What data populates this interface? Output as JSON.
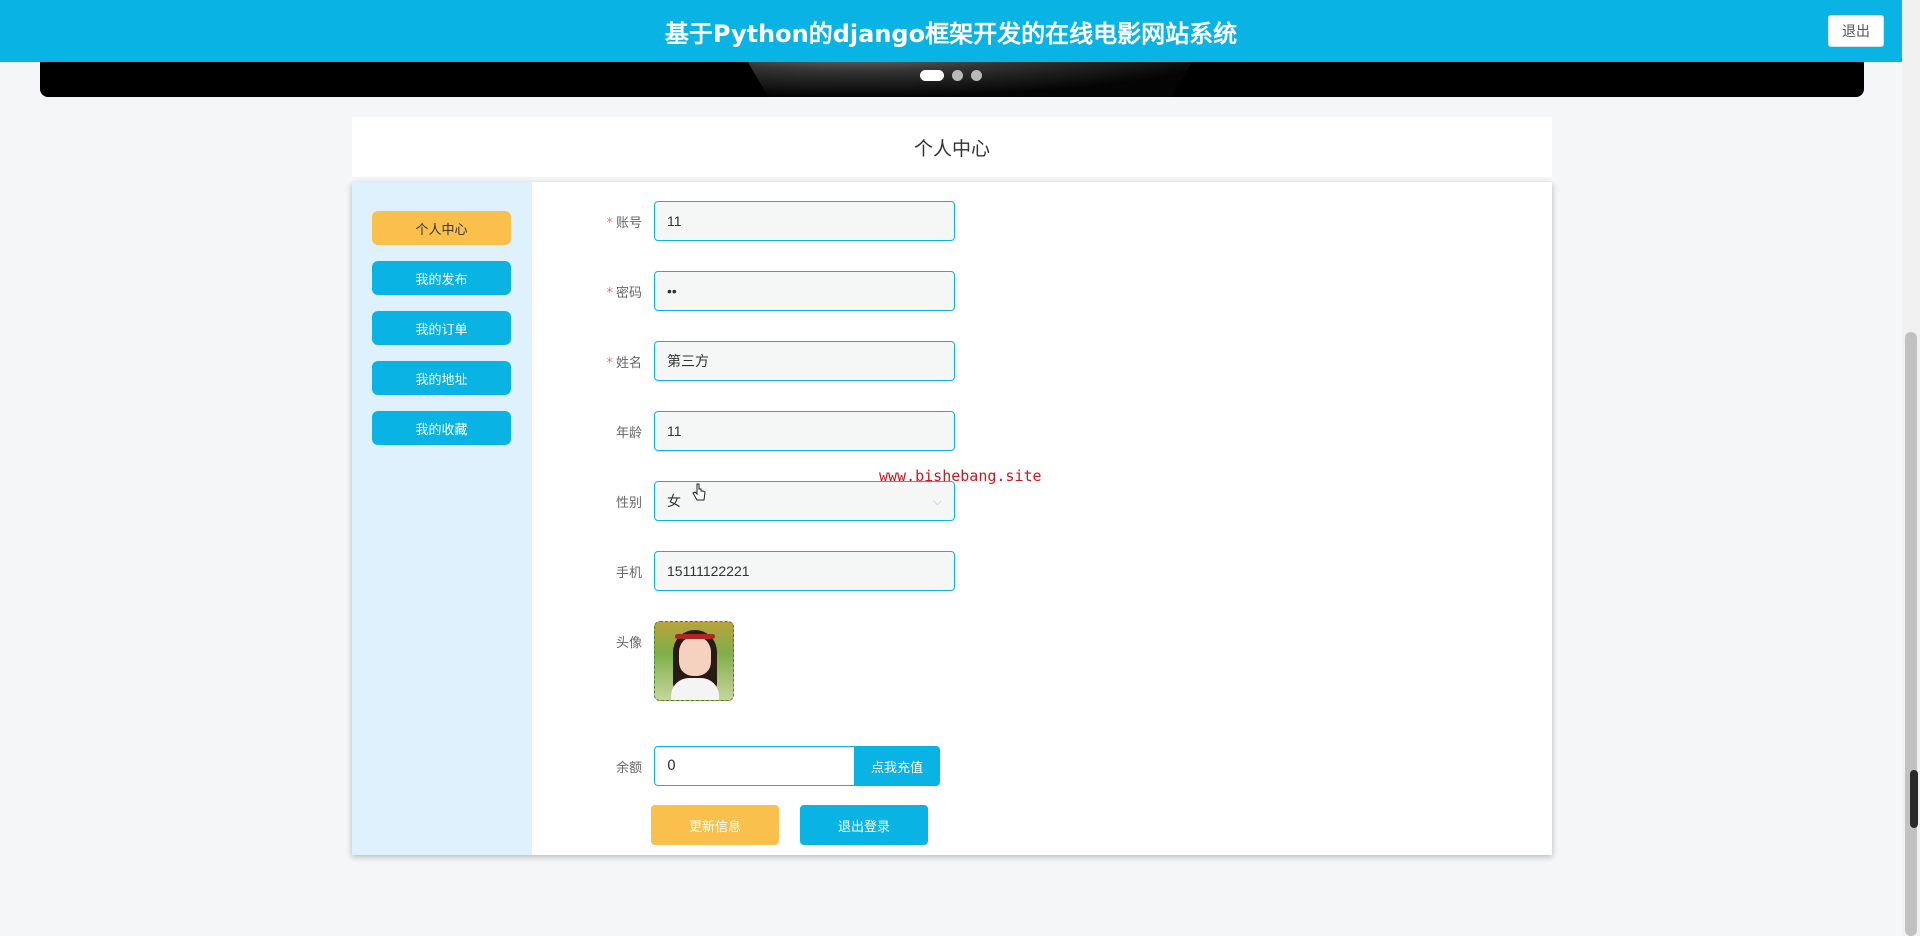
{
  "header": {
    "title": "基于Python的django框架开发的在线电影网站系统",
    "logout_label": "退出"
  },
  "banner": {
    "dots": 3,
    "active_dot": 0
  },
  "page": {
    "title": "个人中心"
  },
  "sidebar": {
    "items": [
      {
        "label": "个人中心",
        "active": true
      },
      {
        "label": "我的发布",
        "active": false
      },
      {
        "label": "我的订单",
        "active": false
      },
      {
        "label": "我的地址",
        "active": false
      },
      {
        "label": "我的收藏",
        "active": false
      }
    ]
  },
  "form": {
    "account": {
      "label": "账号",
      "required": "*",
      "value": "11"
    },
    "password": {
      "label": "密码",
      "required": "*",
      "value": "••"
    },
    "name": {
      "label": "姓名",
      "required": "*",
      "value": "第三方"
    },
    "age": {
      "label": "年龄",
      "value": "11"
    },
    "gender": {
      "label": "性别",
      "value": "女"
    },
    "phone": {
      "label": "手机",
      "value": "15111122221"
    },
    "avatar": {
      "label": "头像"
    },
    "balance": {
      "label": "余额",
      "value": "0",
      "recharge_label": "点我充值"
    }
  },
  "actions": {
    "update_label": "更新信息",
    "logout_label": "退出登录"
  },
  "watermark": "www.bishebang.site",
  "colors": {
    "primary": "#09b4e5",
    "accent": "#f9c04c",
    "required": "#f56c6c",
    "sidebar_bg": "#dff1fd"
  }
}
